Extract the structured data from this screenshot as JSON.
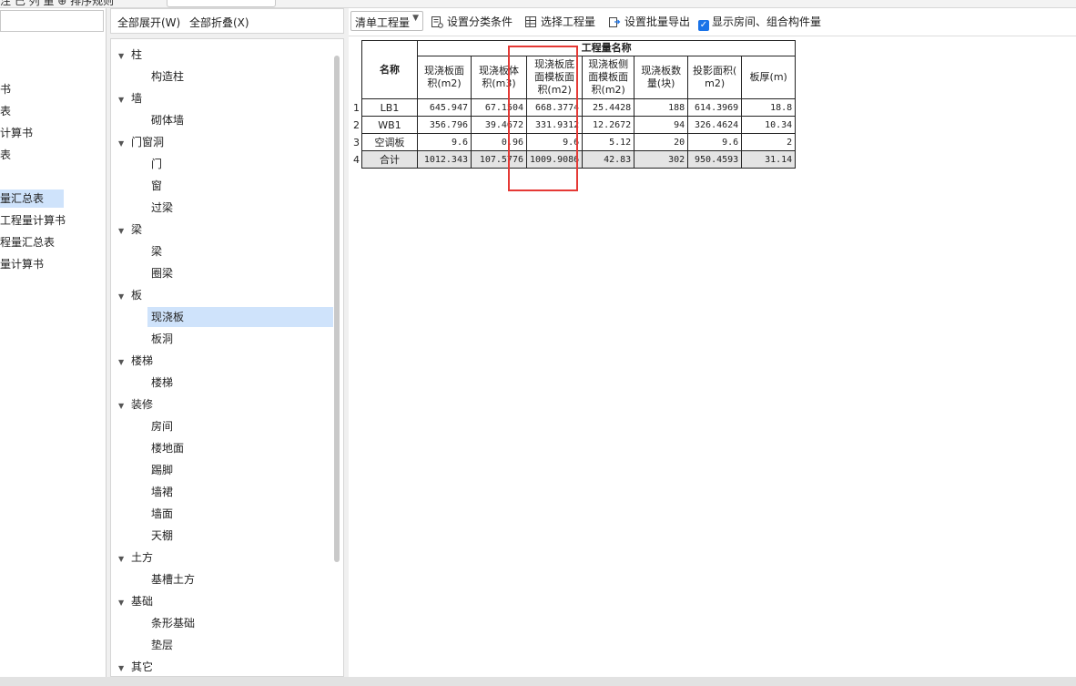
{
  "top": {
    "partial_text": "注 己 列 量    ⊕ 排序规则"
  },
  "left_panel": {
    "items": [
      {
        "label": "书",
        "selected": false
      },
      {
        "label": "表",
        "selected": false
      },
      {
        "label": "计算书",
        "selected": false
      },
      {
        "label": "表",
        "selected": false
      },
      {
        "label": "量汇总表",
        "selected": true
      },
      {
        "label": "工程量计算书",
        "selected": false
      },
      {
        "label": "程量汇总表",
        "selected": false
      },
      {
        "label": "量计算书",
        "selected": false
      }
    ]
  },
  "tree_header": {
    "expand_all": "全部展开(W)",
    "collapse_all": "全部折叠(X)"
  },
  "tree": [
    {
      "label": "柱",
      "children": [
        "构造柱"
      ]
    },
    {
      "label": "墙",
      "children": [
        "砌体墙"
      ]
    },
    {
      "label": "门窗洞",
      "children": [
        "门",
        "窗",
        "过梁"
      ]
    },
    {
      "label": "梁",
      "children": [
        "梁",
        "圈梁"
      ]
    },
    {
      "label": "板",
      "children": [
        "现浇板",
        "板洞"
      ]
    },
    {
      "label": "楼梯",
      "children": [
        "楼梯"
      ]
    },
    {
      "label": "装修",
      "children": [
        "房间",
        "楼地面",
        "踢脚",
        "墙裙",
        "墙面",
        "天棚"
      ]
    },
    {
      "label": "土方",
      "children": [
        "基槽土方"
      ]
    },
    {
      "label": "基础",
      "children": [
        "条形基础",
        "垫层"
      ]
    },
    {
      "label": "其它",
      "children": []
    }
  ],
  "tree_selected": "现浇板",
  "toolbar": {
    "dropdown": "清单工程量",
    "set_category": "设置分类条件",
    "select_quantity": "选择工程量",
    "batch_export": "设置批量导出",
    "show_rooms": "显示房间、组合构件量"
  },
  "table": {
    "group_header": "工程量名称",
    "name_header": "名称",
    "columns": [
      "现浇板面积(m2)",
      "现浇板体积(m3)",
      "现浇板底面模板面积(m2)",
      "现浇板侧面模板面积(m2)",
      "现浇板数量(块)",
      "投影面积(m2)",
      "板厚(m)"
    ],
    "columns_display": [
      [
        "现浇板面",
        "积(m2)"
      ],
      [
        "现浇板体",
        "积(m3)"
      ],
      [
        "现浇板底",
        "面模板面",
        "积(m2)"
      ],
      [
        "现浇板侧",
        "面模板面",
        "积(m2)"
      ],
      [
        "现浇板数",
        "量(块)"
      ],
      [
        "投影面积(",
        "m2)"
      ],
      [
        "板厚(m)"
      ]
    ],
    "rows": [
      {
        "idx": "1",
        "name": "LB1",
        "values": [
          "645.947",
          "67.1504",
          "668.3774",
          "25.4428",
          "188",
          "614.3969",
          "18.8"
        ]
      },
      {
        "idx": "2",
        "name": "WB1",
        "values": [
          "356.796",
          "39.4672",
          "331.9312",
          "12.2672",
          "94",
          "326.4624",
          "10.34"
        ]
      },
      {
        "idx": "3",
        "name": "空调板",
        "values": [
          "9.6",
          "0.96",
          "9.6",
          "5.12",
          "20",
          "9.6",
          "2"
        ]
      },
      {
        "idx": "4",
        "name": "合计",
        "values": [
          "1012.343",
          "107.5776",
          "1009.9086",
          "42.83",
          "302",
          "950.4593",
          "31.14"
        ],
        "total": true
      }
    ]
  }
}
